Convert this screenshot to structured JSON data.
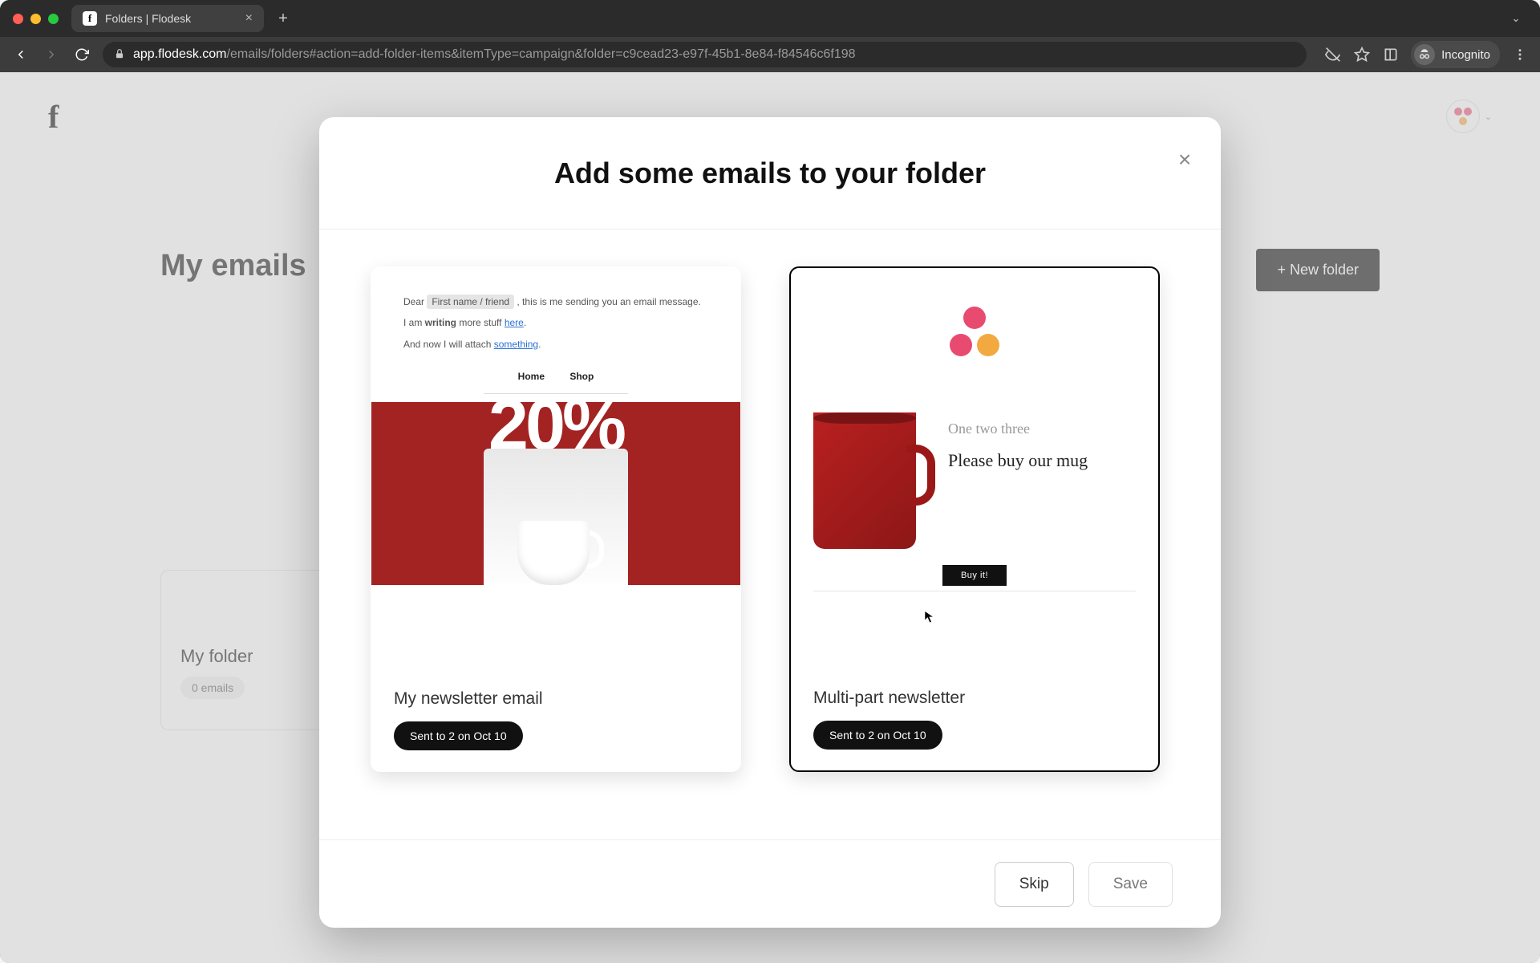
{
  "browser": {
    "tab_title": "Folders | Flodesk",
    "url_host": "app.flodesk.com",
    "url_path": "/emails/folders#action=add-folder-items&itemType=campaign&folder=c9cead23-e97f-45b1-8e84-f84546c6f198",
    "incognito_label": "Incognito"
  },
  "page": {
    "title": "My emails",
    "new_folder_button": "+ New folder",
    "folder": {
      "name": "My folder",
      "count_label": "0 emails"
    }
  },
  "modal": {
    "title": "Add some emails to your folder",
    "skip_label": "Skip",
    "save_label": "Save",
    "emails": [
      {
        "name": "My newsletter email",
        "status": "Sent to 2 on Oct 10",
        "selected": false,
        "preview": {
          "greeting_pre": "Dear ",
          "merge_tag": "First name / friend",
          "greeting_post": " , this is me sending you an email message.",
          "line2_a": "I am ",
          "line2_bold": "writing",
          "line2_b": " more stuff ",
          "line2_link": "here",
          "line3_a": "And now I will attach ",
          "line3_link": "something",
          "nav_home": "Home",
          "nav_shop": "Shop"
        }
      },
      {
        "name": "Multi-part newsletter",
        "status": "Sent to 2 on Oct 10",
        "selected": true,
        "preview": {
          "script_text": "One   two three",
          "headline": "Please buy our mug",
          "cta": "Buy it!"
        }
      }
    ]
  }
}
